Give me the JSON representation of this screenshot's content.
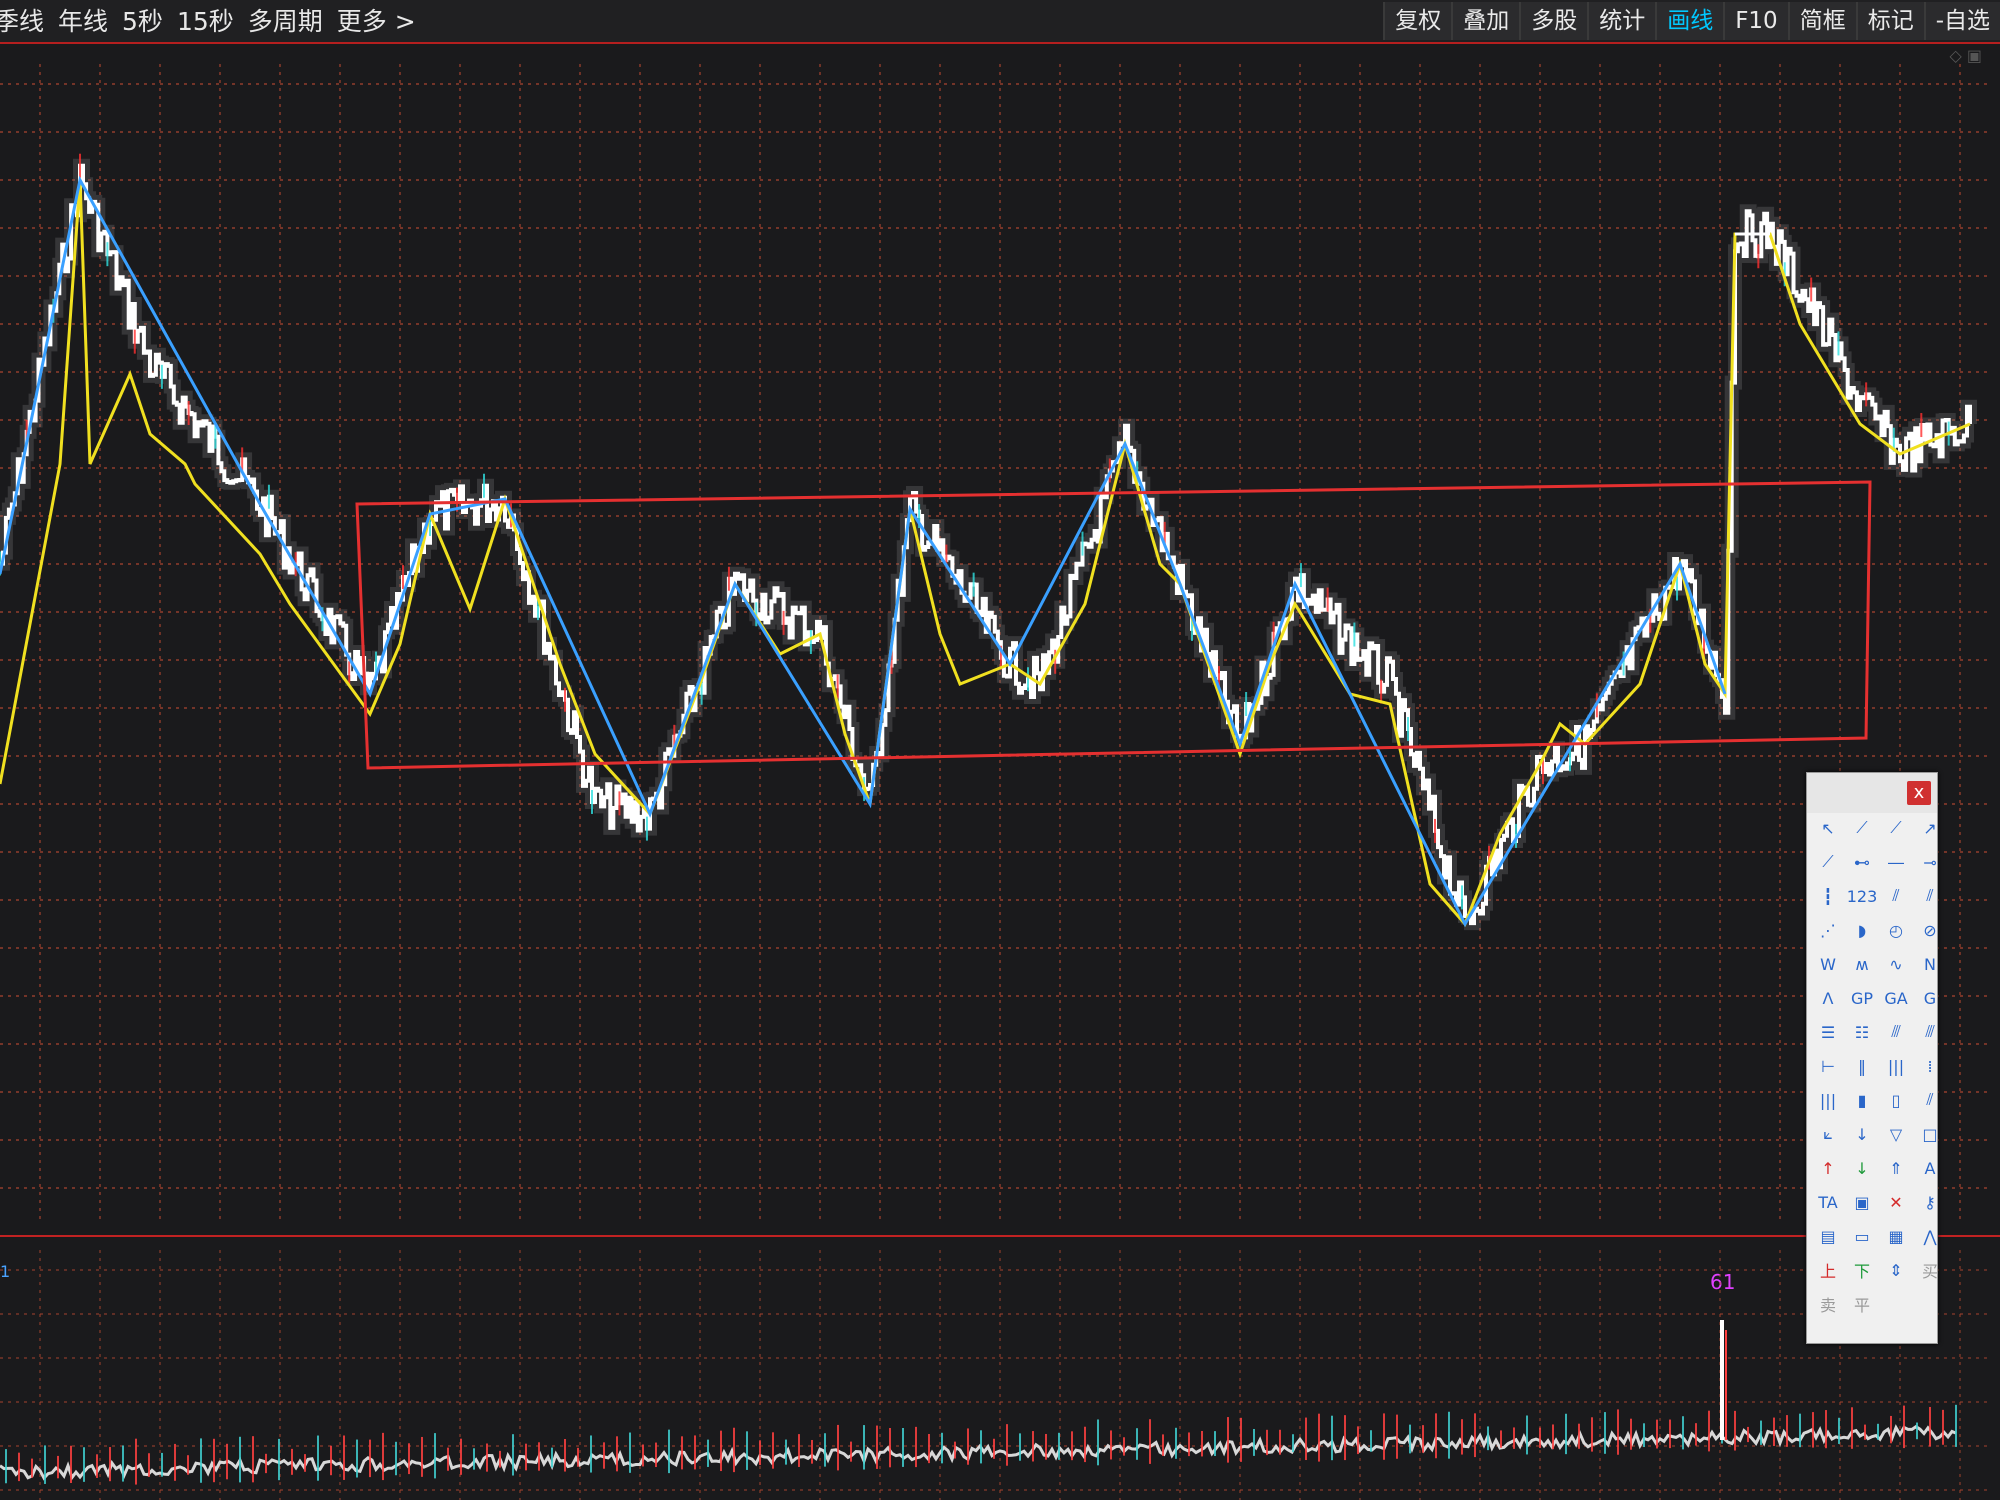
{
  "periods": [
    "季线",
    "年线",
    "5秒",
    "15秒",
    "多周期",
    "更多 >"
  ],
  "toolbar": {
    "buttons": [
      "复权",
      "叠加",
      "多股",
      "统计",
      "画线",
      "F10",
      "简框",
      "标记",
      "-自选"
    ],
    "active": "画线"
  },
  "volume_label": "61",
  "left_marker": "1",
  "tools_panel": {
    "close_label": "x",
    "tools": [
      {
        "name": "select-tool",
        "glyph": "↖"
      },
      {
        "name": "segment-tool",
        "glyph": "⟋"
      },
      {
        "name": "line-tool",
        "glyph": "⟋"
      },
      {
        "name": "ray-tool",
        "glyph": "↗"
      },
      {
        "name": "trend-line-tool",
        "glyph": "⟋"
      },
      {
        "name": "horizontal-segment-tool",
        "glyph": "⊷"
      },
      {
        "name": "horizontal-line-tool",
        "glyph": "―"
      },
      {
        "name": "horizontal-ray-tool",
        "glyph": "⊸"
      },
      {
        "name": "vertical-line-tool",
        "glyph": "┇"
      },
      {
        "name": "price-label-tool",
        "glyph": "123"
      },
      {
        "name": "parallel-line-tool",
        "glyph": "⫽"
      },
      {
        "name": "parallel-channel-tool",
        "glyph": "⫽"
      },
      {
        "name": "arc-line-tool",
        "glyph": "⋰"
      },
      {
        "name": "arc-tool",
        "glyph": "◗"
      },
      {
        "name": "circle-tool",
        "glyph": "◴"
      },
      {
        "name": "circle-cross-tool",
        "glyph": "⊘"
      },
      {
        "name": "wave-w-tool",
        "glyph": "W"
      },
      {
        "name": "wave-m-tool",
        "glyph": "ʍ"
      },
      {
        "name": "wave-line-tool",
        "glyph": "∿"
      },
      {
        "name": "wave-n-tool",
        "glyph": "N"
      },
      {
        "name": "wave-a-tool",
        "glyph": "Λ"
      },
      {
        "name": "gann-fan-tool",
        "glyph": "GP"
      },
      {
        "name": "gann-angle-tool",
        "glyph": "GA"
      },
      {
        "name": "gann-tool",
        "glyph": "G"
      },
      {
        "name": "fib-retracement-tool",
        "glyph": "☰"
      },
      {
        "name": "fib-levels-tool",
        "glyph": "☷"
      },
      {
        "name": "fib-fan-tool",
        "glyph": "⫻"
      },
      {
        "name": "fib-channel-tool",
        "glyph": "⫻"
      },
      {
        "name": "range-tool",
        "glyph": "⊢"
      },
      {
        "name": "cycle-lines-tool",
        "glyph": "‖"
      },
      {
        "name": "fib-time-tool",
        "glyph": "|||"
      },
      {
        "name": "time-cycle-tool",
        "glyph": "⁞"
      },
      {
        "name": "period-lines-tool",
        "glyph": "|||"
      },
      {
        "name": "blue-bars-tool",
        "glyph": "▮"
      },
      {
        "name": "gray-bars-tool",
        "glyph": "▯"
      },
      {
        "name": "speed-line-tool",
        "glyph": "⫽"
      },
      {
        "name": "angle-fan-tool",
        "glyph": "⟀"
      },
      {
        "name": "down-arrow-tool",
        "glyph": "↓"
      },
      {
        "name": "triangle-tool",
        "glyph": "▽"
      },
      {
        "name": "rectangle-tool",
        "glyph": "□"
      },
      {
        "name": "up-arrow-red-tool",
        "glyph": "↑"
      },
      {
        "name": "down-arrow-green-tool",
        "glyph": "↓"
      },
      {
        "name": "arrow-marker-tool",
        "glyph": "⇑"
      },
      {
        "name": "text-tool",
        "glyph": "A"
      },
      {
        "name": "text-box-tool",
        "glyph": "TA"
      },
      {
        "name": "fill-tool",
        "glyph": "▣"
      },
      {
        "name": "delete-tool",
        "glyph": "✕"
      },
      {
        "name": "lock-tool",
        "glyph": "⚷"
      },
      {
        "name": "note-tool",
        "glyph": "▤"
      },
      {
        "name": "ruler-tool",
        "glyph": "▭"
      },
      {
        "name": "image-tool",
        "glyph": "▦"
      },
      {
        "name": "peak-tool",
        "glyph": "⋀"
      },
      {
        "name": "up-label-tool",
        "glyph": "上"
      },
      {
        "name": "down-label-tool",
        "glyph": "下"
      },
      {
        "name": "level-marker-tool",
        "glyph": "⇕"
      },
      {
        "name": "buy-label-tool",
        "glyph": "买"
      },
      {
        "name": "sell-label-tool",
        "glyph": "卖"
      },
      {
        "name": "flat-label-tool",
        "glyph": "平"
      }
    ]
  },
  "colors": {
    "background": "#1a1a1c",
    "grid": "#a8442f",
    "price_line": "#ffffff",
    "zigzag_blue": "#3aa0ff",
    "zigzag_yellow": "#f0e020",
    "consolidation_box": "#e53030",
    "active_tab": "#00c8ff"
  }
}
